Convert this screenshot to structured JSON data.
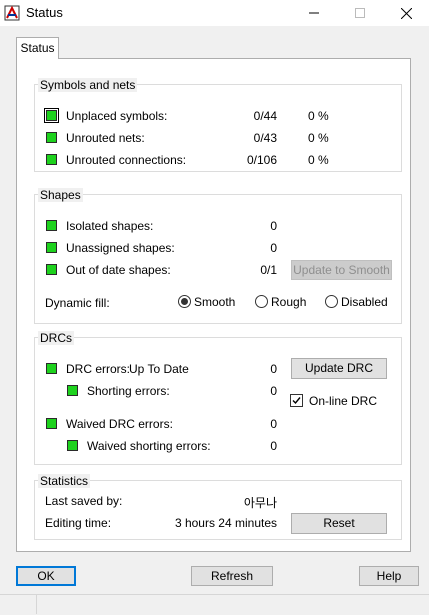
{
  "window": {
    "title": "Status"
  },
  "tabs": [
    {
      "label": "Status"
    }
  ],
  "symbols_nets": {
    "title": "Symbols and nets",
    "rows": [
      {
        "label": "Unplaced symbols:",
        "value": "0/44",
        "pct": "0 %"
      },
      {
        "label": "Unrouted nets:",
        "value": "0/43",
        "pct": "0 %"
      },
      {
        "label": "Unrouted connections:",
        "value": "0/106",
        "pct": "0 %"
      }
    ]
  },
  "shapes": {
    "title": "Shapes",
    "rows": [
      {
        "label": "Isolated shapes:",
        "value": "0"
      },
      {
        "label": "Unassigned shapes:",
        "value": "0"
      },
      {
        "label": "Out of date shapes:",
        "value": "0/1"
      }
    ],
    "update_button": "Update to Smooth",
    "dynamic_fill_label": "Dynamic fill:",
    "fill_options": [
      "Smooth",
      "Rough",
      "Disabled"
    ],
    "fill_selected": "Smooth"
  },
  "drcs": {
    "title": "DRCs",
    "drc_errors_label": "DRC errors:",
    "drc_status": "Up To Date",
    "drc_errors_value": "0",
    "shorting_label": "Shorting errors:",
    "shorting_value": "0",
    "waived_label": "Waived DRC errors:",
    "waived_value": "0",
    "waived_shorting_label": "Waived shorting errors:",
    "waived_shorting_value": "0",
    "update_button": "Update DRC",
    "online_drc_label": "On-line DRC",
    "online_drc_checked": true
  },
  "statistics": {
    "title": "Statistics",
    "last_saved_label": "Last saved by:",
    "last_saved_value": "아무나",
    "editing_time_label": "Editing time:",
    "editing_time_value": "3 hours 24 minutes",
    "reset_button": "Reset"
  },
  "footer": {
    "ok": "OK",
    "refresh": "Refresh",
    "help": "Help"
  },
  "colors": {
    "status_green": "#1ed21e",
    "accent": "#0078d7"
  }
}
